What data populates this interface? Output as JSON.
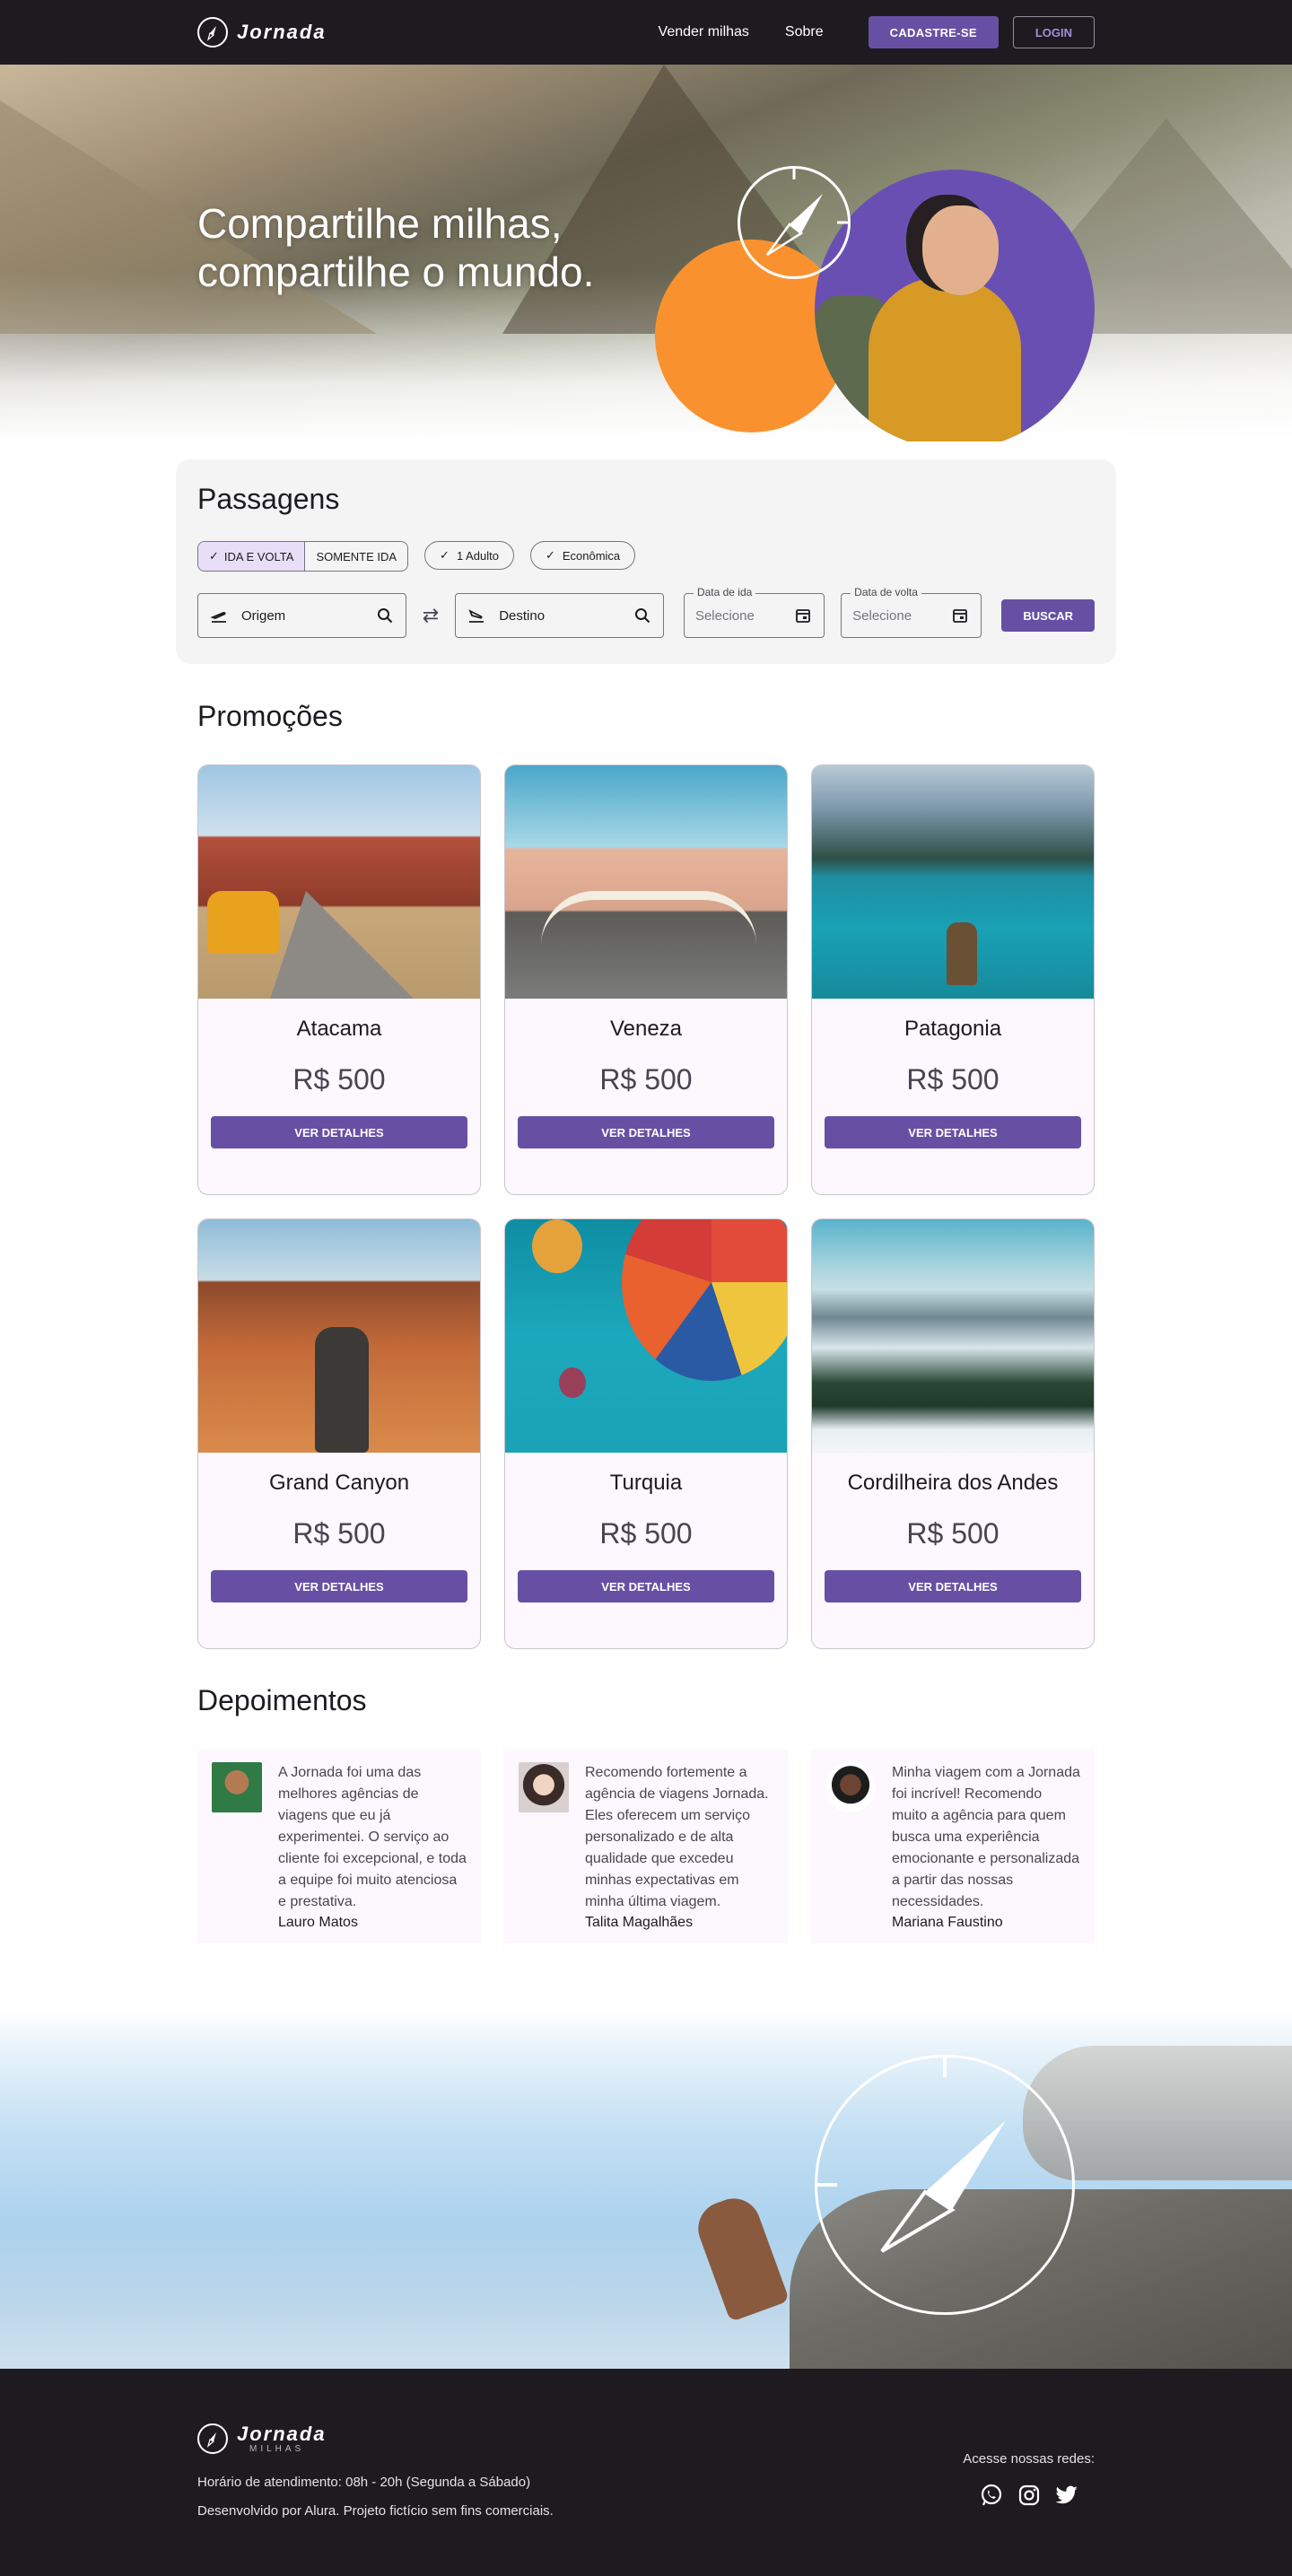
{
  "header": {
    "brand": "Jornada",
    "nav": [
      "Vender milhas",
      "Sobre"
    ],
    "signup_label": "CADASTRE-SE",
    "login_label": "LOGIN"
  },
  "hero": {
    "title_line1": "Compartilhe milhas,",
    "title_line2": "compartilhe o mundo."
  },
  "search": {
    "title": "Passagens",
    "trip_types": [
      "IDA E VOLTA",
      "SOMENTE IDA"
    ],
    "passengers": "1 Adulto",
    "class": "Econômica",
    "origin_placeholder": "Origem",
    "destination_placeholder": "Destino",
    "departure_label": "Data de ida",
    "return_label": "Data de volta",
    "date_placeholder": "Selecione",
    "search_label": "BUSCAR"
  },
  "promotions": {
    "title": "Promoções",
    "button_label": "VER DETALHES",
    "items": [
      {
        "name": "Atacama",
        "price": "R$ 500"
      },
      {
        "name": "Veneza",
        "price": "R$ 500"
      },
      {
        "name": "Patagonia",
        "price": "R$ 500"
      },
      {
        "name": "Grand Canyon",
        "price": "R$ 500"
      },
      {
        "name": "Turquia",
        "price": "R$ 500"
      },
      {
        "name": "Cordilheira dos Andes",
        "price": "R$ 500"
      }
    ]
  },
  "testimonials": {
    "title": "Depoimentos",
    "items": [
      {
        "text": "A Jornada foi uma das melhores agências de viagens que eu já experimentei. O serviço ao cliente foi excepcional, e toda a equipe foi muito atenciosa e prestativa.",
        "author": "Lauro Matos"
      },
      {
        "text": "Recomendo fortemente a agência de viagens Jornada. Eles oferecem um serviço personalizado e de alta qualidade que excedeu minhas expectativas em minha última viagem.",
        "author": "Talita Magalhães"
      },
      {
        "text": "Minha viagem com a Jornada foi incrível! Recomendo muito a agência para quem busca uma experiência emocionante e personalizada a partir das nossas necessidades.",
        "author": "Mariana Faustino"
      }
    ]
  },
  "footer": {
    "brand": "Jornada",
    "brand_sub": "MILHAS",
    "hours": "Horário de atendimento: 08h - 20h (Segunda a Sábado)",
    "credits": "Desenvolvido por Alura. Projeto fictício sem fins comerciais.",
    "social_label": "Acesse nossas redes:",
    "social_icons": [
      "whatsapp-icon",
      "instagram-icon",
      "twitter-icon"
    ]
  },
  "colors": {
    "primary": "#6750a4",
    "dark": "#1d1b20",
    "orange": "#f9922e",
    "card_bg": "#fdf7fe"
  }
}
